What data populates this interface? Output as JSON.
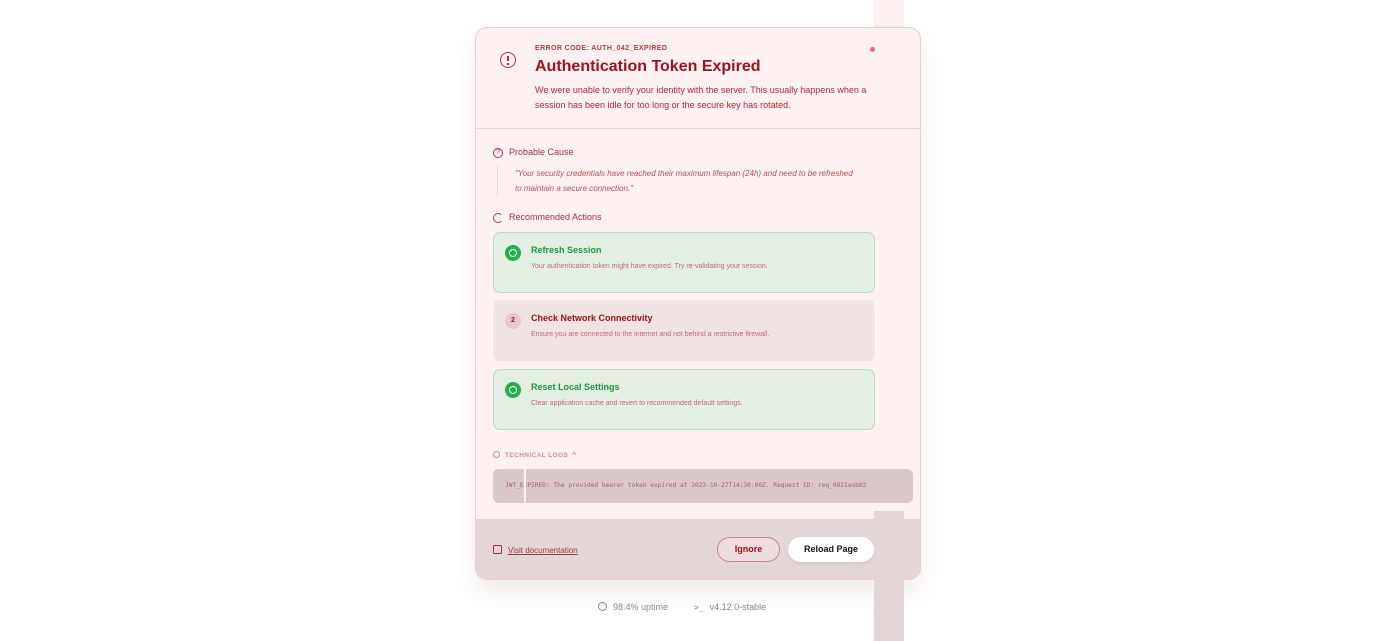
{
  "error": {
    "code": "ERROR CODE: AUTH_042_EXPIRED",
    "title": "Authentication Token Expired",
    "description": "We were unable to verify your identity with the server. This usually happens when a session has been idle for too long or the secure key has rotated."
  },
  "cause": {
    "label": "Probable Cause",
    "quote": "\"Your security credentials have reached their maximum lifespan (24h) and need to be refreshed to maintain a secure connection.\""
  },
  "actions": {
    "label": "Recommended Actions",
    "items": [
      {
        "title": "Refresh Session",
        "description": "Your authentication token might have expired. Try re-validating your session.",
        "status": "completed"
      },
      {
        "number": "2",
        "title": "Check Network Connectivity",
        "description": "Ensure you are connected to the internet and not behind a restrictive firewall.",
        "status": "pending"
      },
      {
        "title": "Reset Local Settings",
        "description": "Clear application cache and revert to recommended default settings.",
        "status": "completed"
      }
    ]
  },
  "logs": {
    "label": "TECHNICAL LOGS",
    "text": "JWT_EXPIRED: The provided bearer token expired at 2023-10-27T14:30:00Z. Request ID: req_0821axb02"
  },
  "footer": {
    "doc_link": "Visit documentation",
    "ignore_label": "Ignore",
    "reload_label": "Reload Page"
  },
  "status_bar": {
    "uptime": "98.4% uptime",
    "version": "v4.12.0-stable"
  },
  "colors": {
    "accent": "#9b1320",
    "success": "#22b14c",
    "card_bg": "#fdf1f1"
  }
}
